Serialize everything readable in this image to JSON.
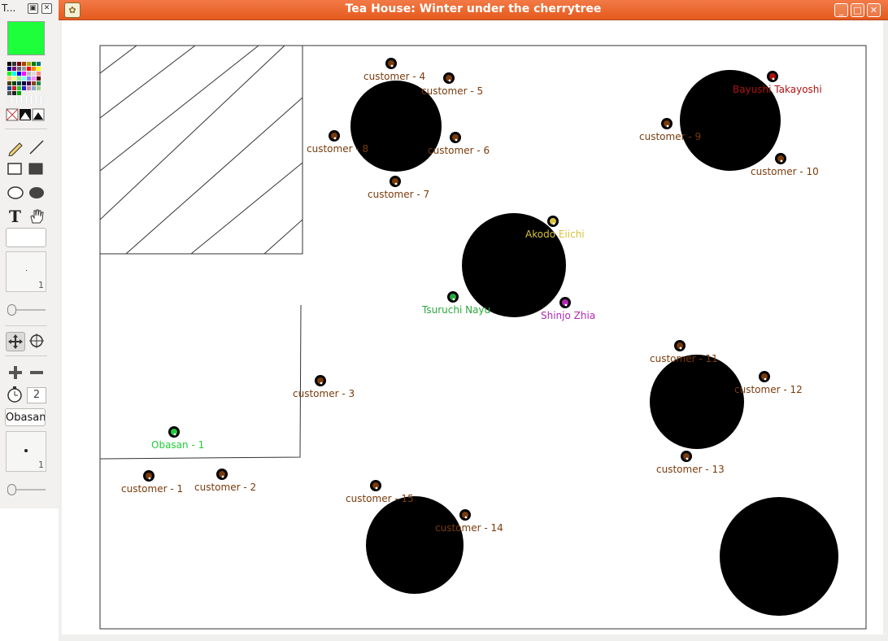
{
  "palette": {
    "title": "T...",
    "buttons": [
      "pin-icon",
      "close-icon"
    ],
    "current_color": "#1eff3c",
    "text_value": "",
    "line_width": "1",
    "timer_value": "2",
    "selected_name": "Obasan",
    "point_size": "1",
    "tools": [
      "pencil-icon",
      "line-icon",
      "rectangle-icon",
      "filled-rectangle-icon",
      "ellipse-icon",
      "filled-ellipse-icon",
      "text-tool-icon",
      "hand-icon",
      "move-icon",
      "crosshair-icon",
      "plus-icon",
      "minus-icon",
      "stopwatch-icon"
    ]
  },
  "window": {
    "title": "Tea House: Winter under the cherrytree",
    "controls": [
      "minimize-icon",
      "maximize-icon",
      "close-icon"
    ]
  },
  "map": {
    "markers": [
      {
        "label": "customer - 1",
        "color": "#7a3b0b"
      },
      {
        "label": "customer - 2",
        "color": "#7a3b0b"
      },
      {
        "label": "customer - 3",
        "color": "#7a3b0b"
      },
      {
        "label": "customer - 4",
        "color": "#7a3b0b"
      },
      {
        "label": "customer - 5",
        "color": "#7a3b0b"
      },
      {
        "label": "customer - 6",
        "color": "#7a3b0b"
      },
      {
        "label": "customer - 7",
        "color": "#7a3b0b"
      },
      {
        "label": "customer - 8",
        "color": "#7a3b0b"
      },
      {
        "label": "customer - 9",
        "color": "#7a3b0b"
      },
      {
        "label": "customer - 10",
        "color": "#7a3b0b"
      },
      {
        "label": "customer - 11",
        "color": "#7a3b0b"
      },
      {
        "label": "customer - 12",
        "color": "#7a3b0b"
      },
      {
        "label": "customer - 13",
        "color": "#7a3b0b"
      },
      {
        "label": "customer - 14",
        "color": "#7a3b0b"
      },
      {
        "label": "customer - 15",
        "color": "#7a3b0b"
      },
      {
        "label": "Obasan - 1",
        "color": "#1ecf36"
      },
      {
        "label": "Bayushi Takayoshi",
        "color": "#b01010"
      },
      {
        "label": "Akodo Eiichi",
        "color": "#d8c23a"
      },
      {
        "label": "Tsuruchi Nayu",
        "color": "#2aa83c"
      },
      {
        "label": "Shinjo Zhia",
        "color": "#b02ab0"
      }
    ]
  }
}
